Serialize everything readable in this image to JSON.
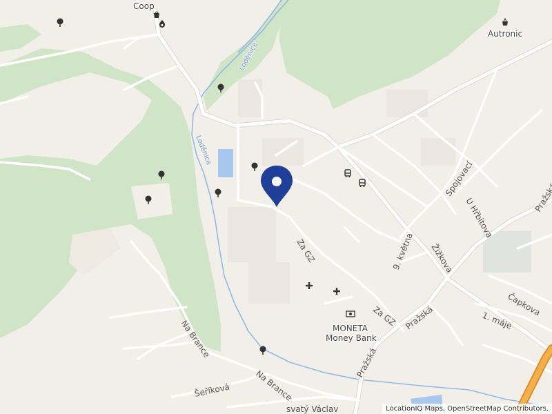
{
  "map": {
    "colors": {
      "background": "#f2efe9",
      "forest": "#cfe5c5",
      "water": "#a8c7ee",
      "river": "#90b8e8",
      "road": "#ffffff",
      "road_casing": "#dcd8d0",
      "motorway": "#f0a23a",
      "marker": "#1f3f99",
      "building": "#e6e3dd"
    },
    "streets": [
      {
        "id": "za-gz-1",
        "name": "Za GZ"
      },
      {
        "id": "za-gz-2",
        "name": "Za GZ"
      },
      {
        "id": "9-kvetna",
        "name": "9. května"
      },
      {
        "id": "zizkova",
        "name": "Žižkova"
      },
      {
        "id": "spojovaci",
        "name": "Spojovací"
      },
      {
        "id": "u-hrbitova",
        "name": "U Hřbitova"
      },
      {
        "id": "prazska-1",
        "name": "Pražská"
      },
      {
        "id": "prazska-2",
        "name": "Pražská"
      },
      {
        "id": "prazska-3",
        "name": "Pražská"
      },
      {
        "id": "capkova",
        "name": "Čapkova"
      },
      {
        "id": "1-maje",
        "name": "1. máje"
      },
      {
        "id": "na-brance-1",
        "name": "Na Brance"
      },
      {
        "id": "na-brance-2",
        "name": "Na Brance"
      },
      {
        "id": "serikova",
        "name": "Šeříková"
      },
      {
        "id": "svaty-vaclav",
        "name": "svatý Václav"
      }
    ],
    "waterways": [
      {
        "id": "lodenice-1",
        "name": "Loděnice"
      },
      {
        "id": "lodenice-2",
        "name": "Loděnice"
      }
    ],
    "pois": [
      {
        "id": "coop",
        "name": "Coop",
        "icon": "shop-icon"
      },
      {
        "id": "autronic",
        "name": "Autronic",
        "icon": "shop-basket-icon"
      },
      {
        "id": "moneta",
        "name": "MONETA",
        "sub": "Money Bank",
        "icon": "bank-icon"
      }
    ],
    "icons": {
      "tree": "tree-icon",
      "bus": "bus-stop-icon",
      "cross": "cross-icon",
      "fuel": "fuel-icon",
      "marker": "location-marker-icon"
    }
  },
  "attribution": "LocationIQ Maps, OpenStreetMap Contributors."
}
